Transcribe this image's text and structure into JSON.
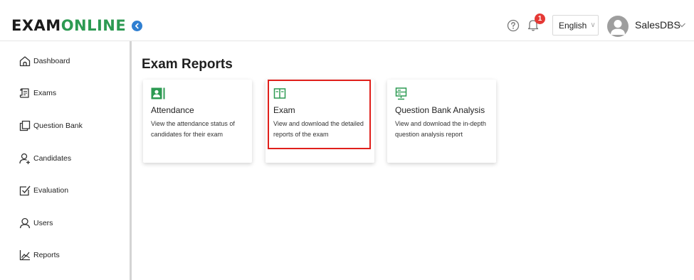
{
  "header": {
    "logo_part1": "EXAM",
    "logo_part2": "ONLINE",
    "notification_count": "1",
    "language": "English",
    "username": "SalesDBS"
  },
  "sidebar": {
    "items": [
      {
        "label": "Dashboard",
        "icon": "home-icon"
      },
      {
        "label": "Exams",
        "icon": "exams-icon"
      },
      {
        "label": "Question Bank",
        "icon": "question-bank-icon"
      },
      {
        "label": "Candidates",
        "icon": "candidates-icon"
      },
      {
        "label": "Evaluation",
        "icon": "evaluation-icon"
      },
      {
        "label": "Users",
        "icon": "users-icon"
      },
      {
        "label": "Reports",
        "icon": "reports-icon"
      }
    ]
  },
  "main": {
    "title": "Exam Reports",
    "cards": [
      {
        "title": "Attendance",
        "description": "View the attendance status of candidates for their exam",
        "icon": "attendance-icon"
      },
      {
        "title": "Exam",
        "description": "View and download the detailed reports of the exam",
        "icon": "exam-book-icon"
      },
      {
        "title": "Question Bank Analysis",
        "description": "View and download the in-depth question analysis report",
        "icon": "analysis-icon"
      }
    ]
  },
  "colors": {
    "brand_green": "#2c9a52",
    "accent_blue": "#2f7fd1",
    "badge_red": "#e53935",
    "highlight_red": "#e0201b"
  }
}
